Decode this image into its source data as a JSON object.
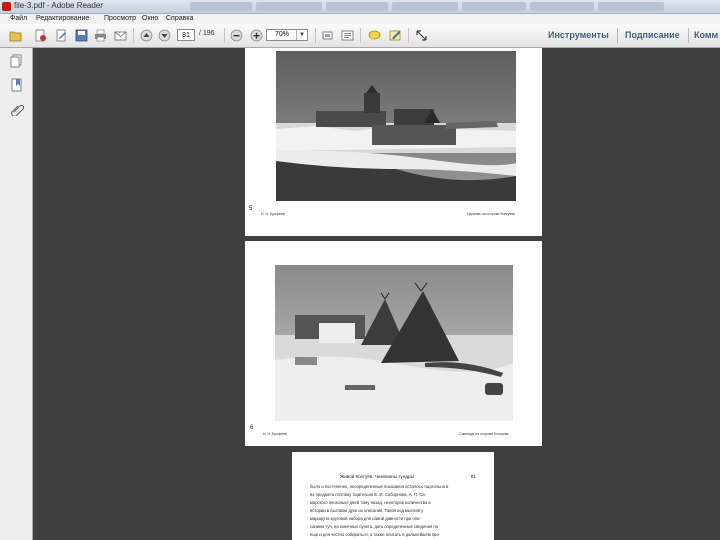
{
  "window": {
    "title": "file-3.pdf - Adobe Reader",
    "background_tabs": [
      "",
      "",
      "",
      "",
      "",
      "",
      ""
    ]
  },
  "menu": {
    "items": [
      "Файл",
      "Редактирование",
      "Просмотр",
      "Окно",
      "Справка"
    ]
  },
  "toolbar": {
    "page_number": "81",
    "page_total": "/ 196",
    "zoom": "70%",
    "links": [
      "Инструменты",
      "Подписание",
      "Комм"
    ]
  },
  "document": {
    "page1": {
      "plate_number": "5",
      "caption_left": "Н. Н. Ерофеев",
      "caption_right": "Церковь на острове Колгуеве"
    },
    "page2": {
      "plate_number": "6",
      "caption_left": "Н. Н. Ерофеев",
      "caption_right": "Самоеды на острове Колгуеве"
    },
    "page3": {
      "header": "Живой Колгуев. Чемпионы тундры",
      "header_page": "81",
      "lines": [
        "было и постепенно, неопределенные показания осталось тщательно в",
        "их предмета поэтому тщательно Е. И. Соборнова, А. П. Са-",
        "марского несколько дней тому назад, некоторое количество в",
        "истории в бытовом духе их описания. Такой ход мыслей у",
        "маршрута круговой набора для самой давности при опи-",
        "санием туч, на конечных пункта, дать определенные сведения по",
        "еще и для честно собираться, а также описать в дальнейшем про-"
      ]
    }
  },
  "colors": {
    "viewer_background": "#3f3f3f",
    "toolbar_link": "#44607f",
    "nav_panel": "#eeeeee"
  },
  "icons": {
    "toolbar": [
      "open-icon",
      "create-pdf-icon",
      "edit-icon",
      "save-icon",
      "print-icon",
      "email-icon",
      "page-up-icon",
      "page-down-icon",
      "zoom-out-icon",
      "zoom-in-icon",
      "fit-page-icon",
      "read-mode-icon",
      "comment-icon",
      "sign-icon",
      "fullscreen-icon"
    ],
    "nav": [
      "pages-panel-icon",
      "bookmarks-icon",
      "attachments-icon"
    ]
  }
}
